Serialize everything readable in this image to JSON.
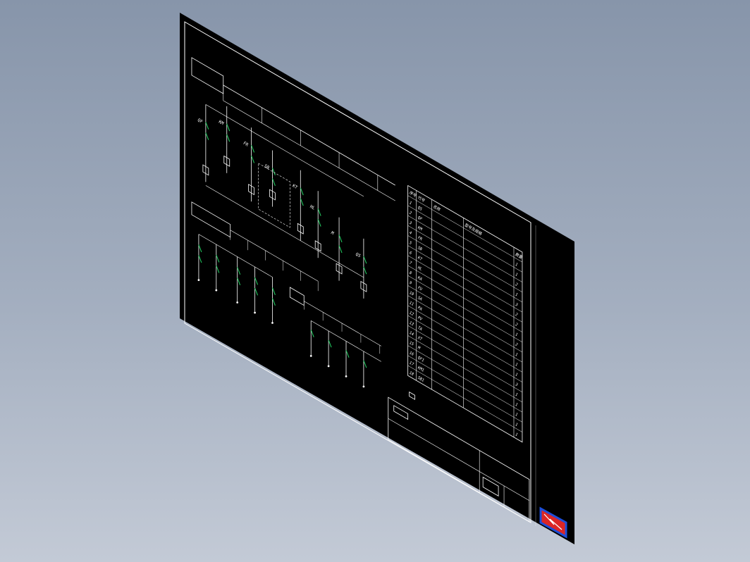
{
  "colors": {
    "background_top": "#8795aa",
    "background_bottom": "#c3cad6",
    "sheet": "#000000",
    "frame_line": "#ffffff",
    "contact_line": "#22c55e",
    "logo_border": "#1d4ed8",
    "logo_fill": "#dc2626"
  },
  "drawing": {
    "circuit_labels": [
      "QF",
      "KM",
      "FR",
      "SB",
      "KT",
      "HL",
      "M",
      "QS"
    ],
    "table": {
      "headers": [
        "序号",
        "代号",
        "名称",
        "型号及规格",
        "数量"
      ],
      "rows": [
        [
          "1",
          "QS",
          "",
          "",
          "1"
        ],
        [
          "2",
          "QF",
          "",
          "",
          "1"
        ],
        [
          "3",
          "KM",
          "",
          "",
          "2"
        ],
        [
          "4",
          "FR",
          "",
          "",
          "1"
        ],
        [
          "5",
          "SB",
          "",
          "",
          "3"
        ],
        [
          "6",
          "KT",
          "",
          "",
          "2"
        ],
        [
          "7",
          "HL",
          "",
          "",
          "2"
        ],
        [
          "8",
          "KA",
          "",
          "",
          "1"
        ],
        [
          "9",
          "FU",
          "",
          "",
          "2"
        ],
        [
          "10",
          "SA",
          "",
          "",
          "1"
        ],
        [
          "11",
          "PA",
          "",
          "",
          "1"
        ],
        [
          "12",
          "PV",
          "",
          "",
          "1"
        ],
        [
          "13",
          "TA",
          "",
          "",
          "3"
        ],
        [
          "14",
          "XT",
          "",
          "",
          "1"
        ],
        [
          "15",
          "M",
          "",
          "",
          "1"
        ],
        [
          "16",
          "QF1",
          "",
          "",
          "1"
        ],
        [
          "17",
          "KM1",
          "",
          "",
          "1"
        ],
        [
          "18",
          "SB1",
          "",
          "",
          "1"
        ]
      ],
      "row_count": 18
    },
    "title_block": {
      "text_lines": 2
    }
  },
  "logo": {
    "icon": "cad-logo-icon"
  }
}
